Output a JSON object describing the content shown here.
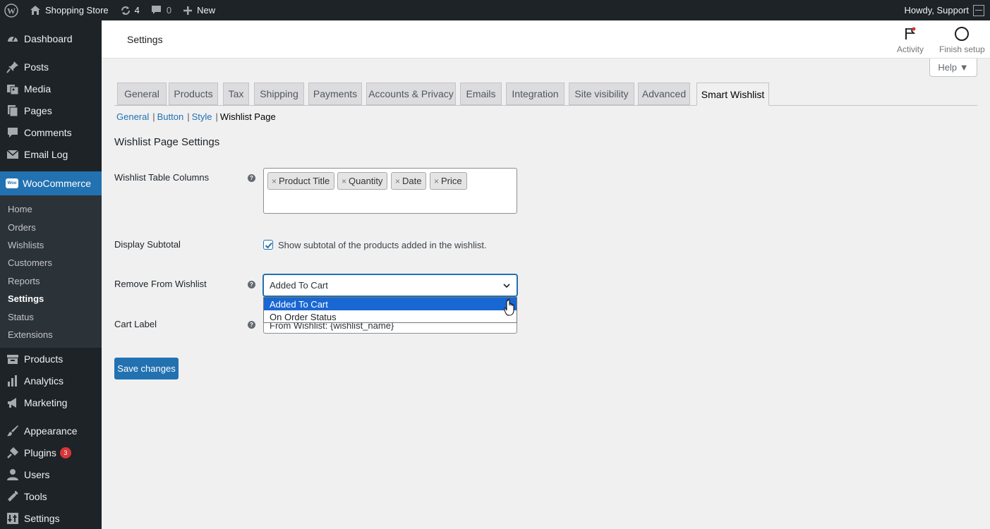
{
  "adminbar": {
    "site_name": "Shopping Store",
    "updates_count": "4",
    "comments_count": "0",
    "new_label": "New",
    "howdy": "Howdy, Support"
  },
  "sidebar": {
    "items_top": [
      {
        "label": "Dashboard",
        "icon": "dashboard-icon"
      },
      {
        "label": "Posts",
        "icon": "pin-icon"
      },
      {
        "label": "Media",
        "icon": "media-icon"
      },
      {
        "label": "Pages",
        "icon": "pages-icon"
      },
      {
        "label": "Comments",
        "icon": "comment-icon"
      },
      {
        "label": "Email Log",
        "icon": "email-icon"
      }
    ],
    "woocommerce": "WooCommerce",
    "woo_icon_text": "Woo",
    "woo_submenu": [
      "Home",
      "Orders",
      "Wishlists",
      "Customers",
      "Reports",
      "Settings",
      "Status",
      "Extensions"
    ],
    "items_bottom": [
      {
        "label": "Products",
        "icon": "archive-icon"
      },
      {
        "label": "Analytics",
        "icon": "chart-icon"
      },
      {
        "label": "Marketing",
        "icon": "megaphone-icon"
      },
      {
        "label": "Appearance",
        "icon": "brush-icon"
      },
      {
        "label": "Plugins",
        "icon": "plug-icon",
        "badge": "3"
      },
      {
        "label": "Users",
        "icon": "user-icon"
      },
      {
        "label": "Tools",
        "icon": "wrench-icon"
      },
      {
        "label": "Settings",
        "icon": "settings-icon"
      }
    ]
  },
  "header": {
    "title": "Settings",
    "activity_label": "Activity",
    "finish_label": "Finish setup",
    "help_label": "Help ▼"
  },
  "tabs": [
    "General",
    "Products",
    "Tax",
    "Shipping",
    "Payments",
    "Accounts & Privacy",
    "Emails",
    "Integration",
    "Site visibility",
    "Advanced",
    "Smart Wishlist"
  ],
  "active_tab": "Smart Wishlist",
  "subnav": {
    "general": "General",
    "button": "Button",
    "style": "Style",
    "current": "Wishlist Page",
    "sep": "|"
  },
  "section_title": "Wishlist Page Settings",
  "fields": {
    "columns_label": "Wishlist Table Columns",
    "columns": [
      "Product Title",
      "Quantity",
      "Date",
      "Price"
    ],
    "chip_remove": "×",
    "subtotal_label": "Display Subtotal",
    "subtotal_text": "Show subtotal of the products added in the wishlist.",
    "subtotal_checked": true,
    "remove_label": "Remove From Wishlist",
    "remove_value": "Added To Cart",
    "remove_options": [
      "Added To Cart",
      "On Order Status"
    ],
    "cart_label_label": "Cart Label",
    "cart_label_value": "From Wishlist: {wishlist_name}",
    "help_tip": "?"
  },
  "save_button": "Save changes",
  "colors": {
    "accent": "#2271b1",
    "admin_bg": "#1d2327",
    "badge": "#d63638",
    "option_highlight": "#1967d2"
  }
}
